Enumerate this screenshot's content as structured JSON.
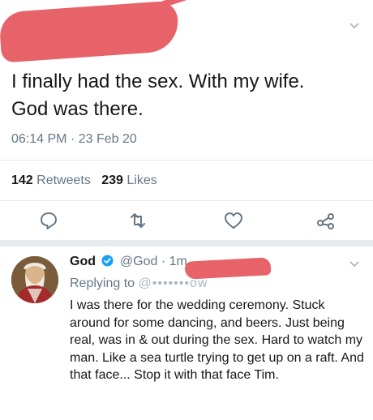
{
  "main_tweet": {
    "text": "I finally had the sex. With my wife.\nGod was there.",
    "time": "06:14 PM",
    "date": "23 Feb 20",
    "retweets_count": "142",
    "retweets_label": "Retweets",
    "likes_count": "239",
    "likes_label": "Likes",
    "icons": [
      "reply-icon",
      "retweet-icon",
      "like-icon",
      "share-icon",
      "chevron-down-icon"
    ]
  },
  "reply_tweet": {
    "name": "God",
    "handle": "@God",
    "age": "1m",
    "replying_label": "Replying to",
    "replying_handle": "@•••••••ow",
    "text": "I was there for the wedding ceremony. Stuck around for some dancing, and beers. Just being real, was in & out during the sex. Hard to watch my man. Like a sea turtle trying to get up on a raft. And that face... Stop it with that face Tim.",
    "icons": [
      "verified-badge-icon",
      "chevron-down-icon"
    ]
  },
  "colors": {
    "redaction": "#e8626a",
    "secondary_text": "#657786",
    "verified_blue": "#1da1f2",
    "icon_gray": "#657786"
  }
}
